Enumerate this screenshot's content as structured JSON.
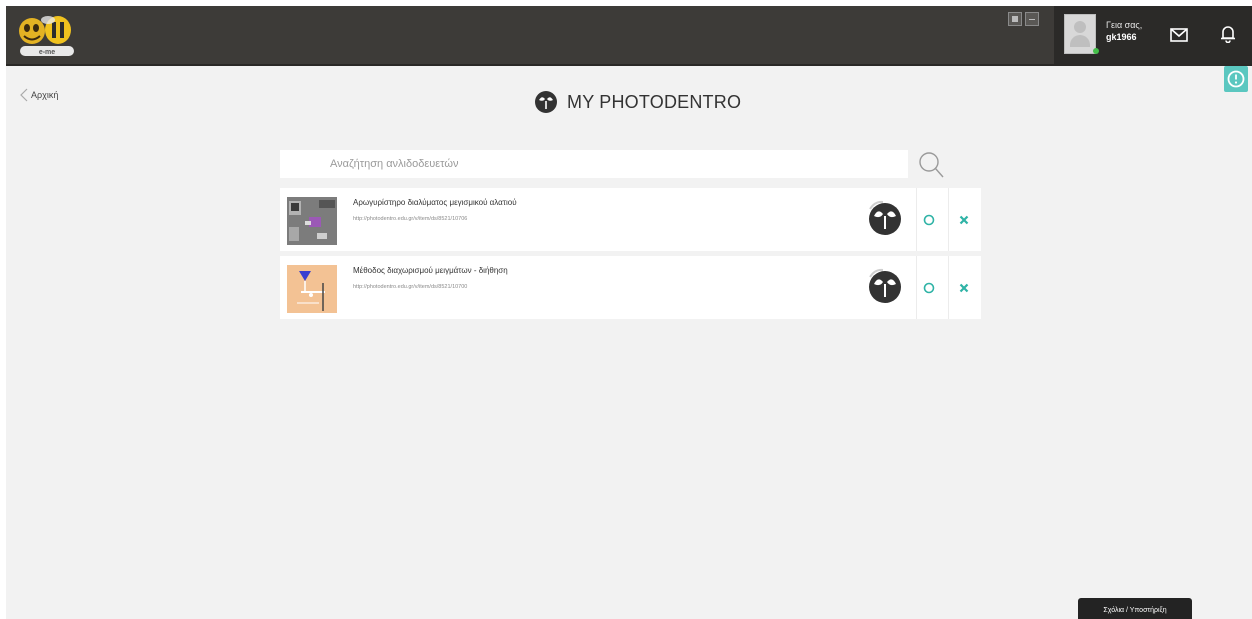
{
  "header": {
    "user": {
      "greeting": "Γεια σας,",
      "username": "gk1966"
    }
  },
  "nav": {
    "back_label": "Αρχική"
  },
  "page": {
    "title": "MY PHOTODENTRO"
  },
  "search": {
    "placeholder": "Αναζήτηση ανλιδοδευετών"
  },
  "items": [
    {
      "title": "Αρωγυρίστηρο διαλύματος μεγισμικού αλατιού",
      "url": "http://photodentro.edu.gr/v/item/ds/8521/10706"
    },
    {
      "title": "Μέθοδος διαχωρισμού μειγμάτων - διήθηση",
      "url": "http://photodentro.edu.gr/v/item/ds/8521/10700"
    }
  ],
  "footer": {
    "help_label": "Σχόλια / Υποστήριξη"
  },
  "colors": {
    "topbar": "#3d3b38",
    "accent": "#5bc7c0",
    "action": "#2fb3a6"
  }
}
